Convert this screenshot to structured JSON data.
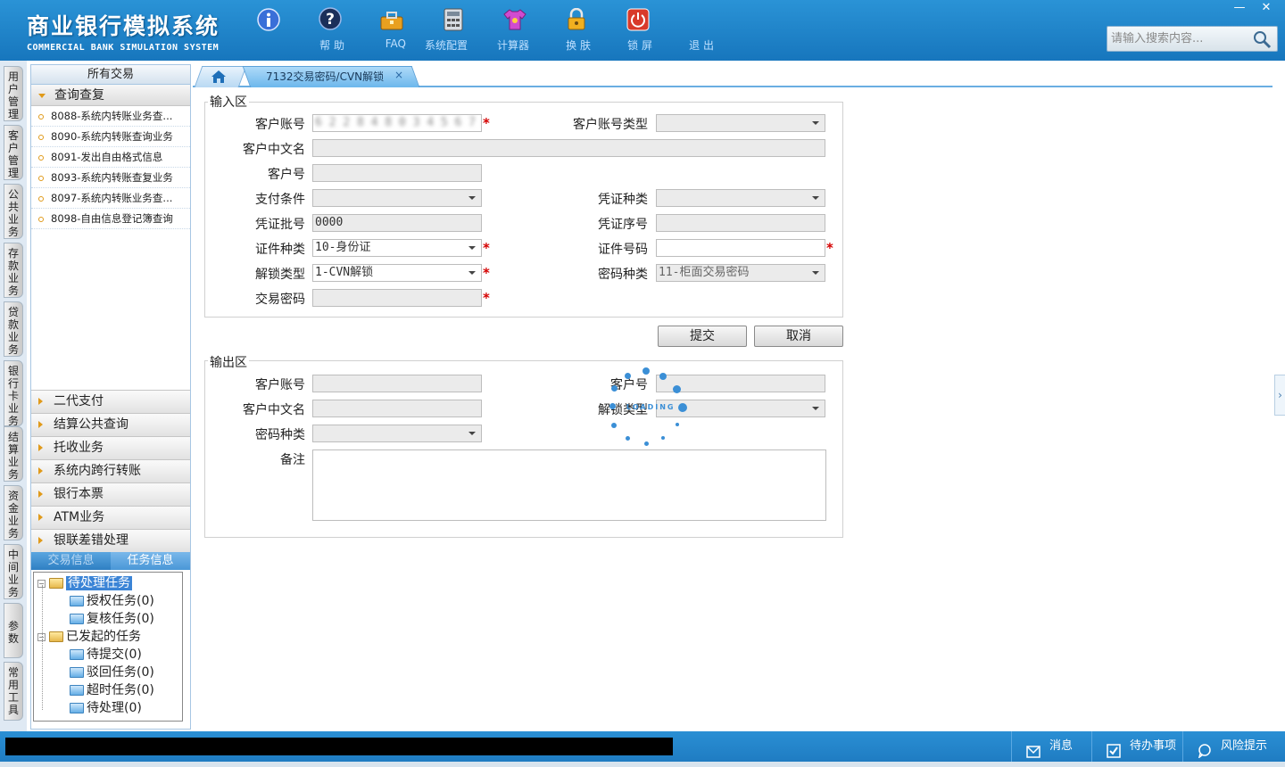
{
  "app": {
    "title_cn": "商业银行模拟系统",
    "title_en": "COMMERCIAL BANK SIMULATION SYSTEM"
  },
  "toolbar": [
    {
      "label": "帮 助",
      "icon": "info-icon"
    },
    {
      "label": "FAQ",
      "icon": "question-icon"
    },
    {
      "label": "系统配置",
      "icon": "toolbox-icon"
    },
    {
      "label": "计算器",
      "icon": "calculator-icon"
    },
    {
      "label": "换 肤",
      "icon": "shirt-icon"
    },
    {
      "label": "锁 屏",
      "icon": "lock-icon"
    },
    {
      "label": "退 出",
      "icon": "power-icon"
    }
  ],
  "window_buttons": {
    "minimize": "—",
    "close": "✕"
  },
  "search": {
    "placeholder": "请输入搜索内容..."
  },
  "side_tabs": [
    "用户管理",
    "客户管理",
    "公共业务",
    "存款业务",
    "贷款业务",
    "银行卡业务",
    "结算业务",
    "资金业务",
    "中间业务",
    "参数",
    "常用工具"
  ],
  "left_panel": {
    "title": "所有交易",
    "open_group": "查询查复",
    "items": [
      "8088-系统内转账业务查...",
      "8090-系统内转账查询业务",
      "8091-发出自由格式信息",
      "8093-系统内转账查复业务",
      "8097-系统内转账业务查...",
      "8098-自由信息登记簿查询"
    ],
    "groups": [
      "二代支付",
      "结算公共查询",
      "托收业务",
      "系统内跨行转账",
      "银行本票",
      "ATM业务",
      "银联差错处理"
    ],
    "info_tabs": {
      "trans": "交易信息",
      "task": "任务信息"
    },
    "tree": {
      "pending_root": "待处理任务",
      "pending_children": [
        "授权任务(0)",
        "复核任务(0)"
      ],
      "initiated_root": "已发起的任务",
      "initiated_children": [
        "待提交(0)",
        "驳回任务(0)",
        "超时任务(0)",
        "待处理(0)"
      ]
    }
  },
  "tabs": {
    "active": "7132交易密码/CVN解锁",
    "close": "×"
  },
  "input_area": {
    "legend": "输入区",
    "fields": {
      "account_no": {
        "label": "客户账号",
        "value": "6 2 2 8 4 8 0 3 4 5 6 7 8 9"
      },
      "account_type": {
        "label": "客户账号类型",
        "value": ""
      },
      "cn_name": {
        "label": "客户中文名",
        "value": ""
      },
      "cust_no": {
        "label": "客户号",
        "value": ""
      },
      "pay_cond": {
        "label": "支付条件",
        "value": ""
      },
      "voucher_kind": {
        "label": "凭证种类",
        "value": ""
      },
      "voucher_batch": {
        "label": "凭证批号",
        "value": "0000"
      },
      "voucher_seq": {
        "label": "凭证序号",
        "value": ""
      },
      "id_kind": {
        "label": "证件种类",
        "value": "10-身份证"
      },
      "id_no": {
        "label": "证件号码",
        "value": ""
      },
      "unlock_type": {
        "label": "解锁类型",
        "value": "1-CVN解锁"
      },
      "pwd_kind": {
        "label": "密码种类",
        "value": "11-柜面交易密码"
      },
      "trans_pwd": {
        "label": "交易密码",
        "value": ""
      }
    },
    "required_mark": "*"
  },
  "buttons": {
    "submit": "提交",
    "cancel": "取消"
  },
  "output_area": {
    "legend": "输出区",
    "fields": {
      "account_no": {
        "label": "客户账号"
      },
      "cust_no": {
        "label": "客户号"
      },
      "cn_name": {
        "label": "客户中文名"
      },
      "unlock_type": {
        "label": "解锁类型"
      },
      "pwd_kind": {
        "label": "密码种类"
      },
      "remark": {
        "label": "备注"
      }
    }
  },
  "loading_text": "LOADING",
  "statusbar": {
    "msg": "消息",
    "todo": "待办事项",
    "risk": "风险提示"
  },
  "colors": {
    "header": "#1e84c8",
    "accent": "#3b84d6",
    "required": "#d40000"
  }
}
